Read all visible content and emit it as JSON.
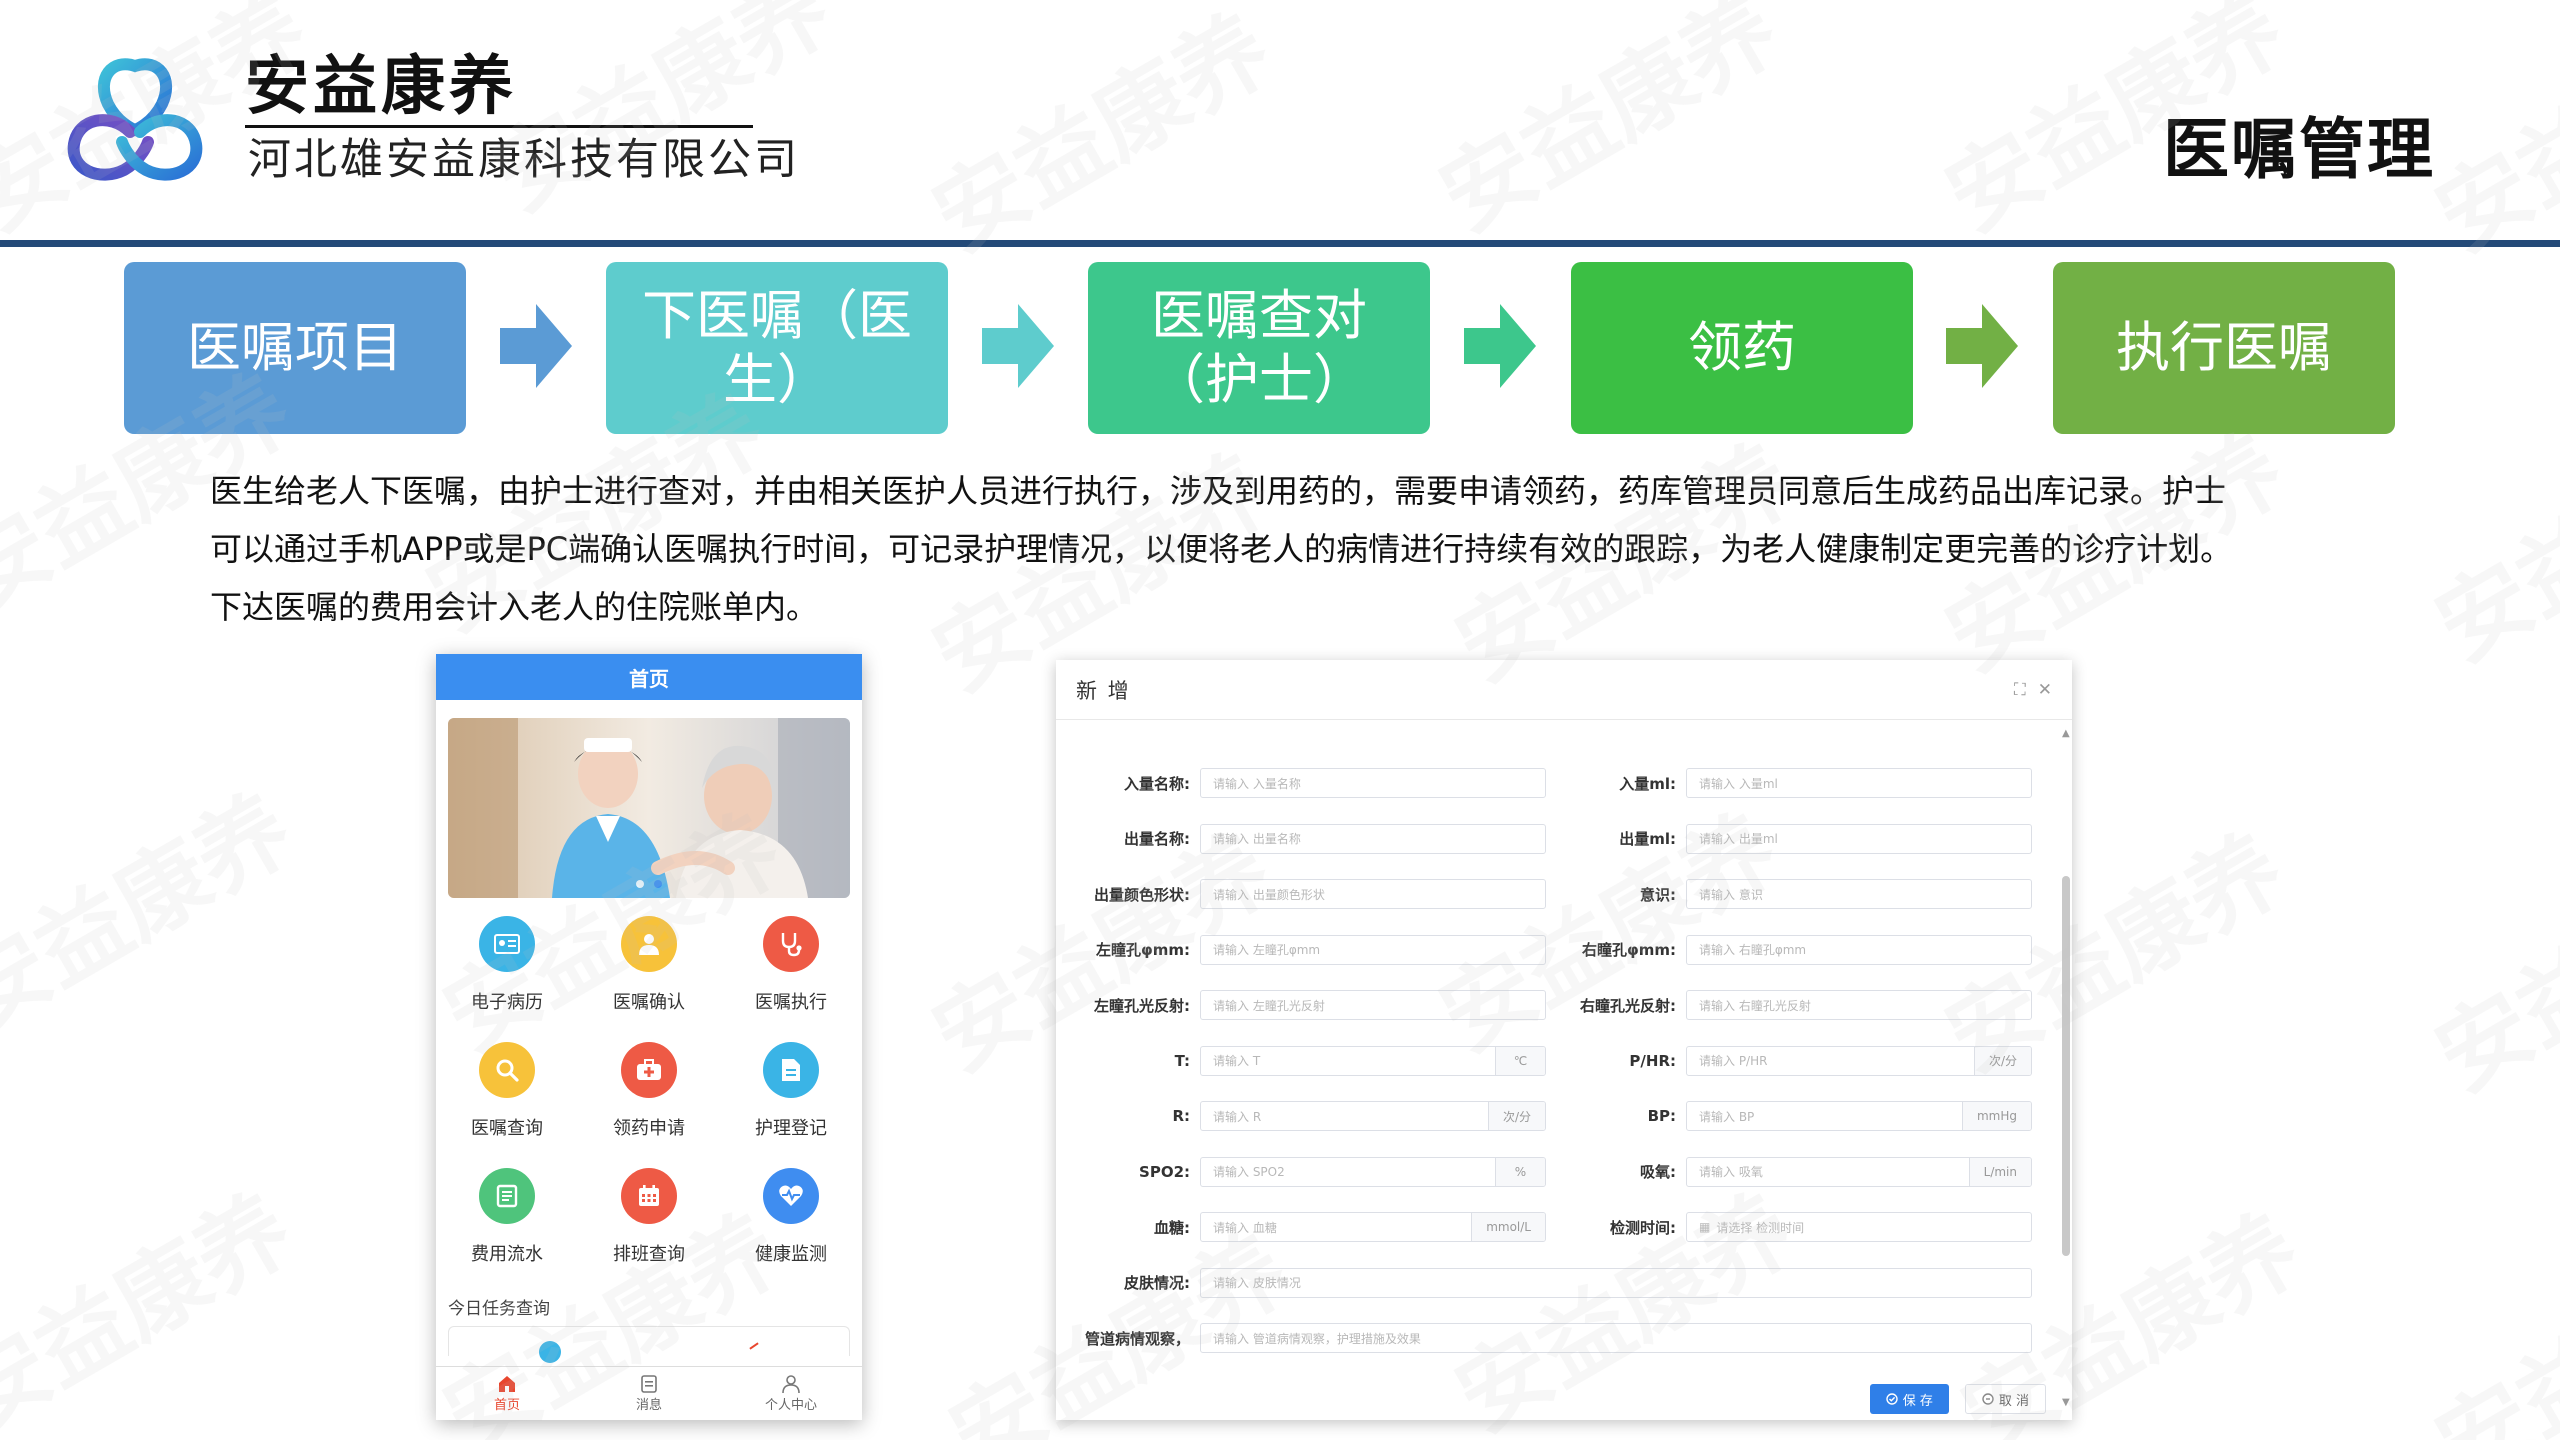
{
  "header": {
    "brand": "安益康养",
    "company": "河北雄安益康科技有限公司",
    "page_title": "医嘱管理"
  },
  "watermark": "安益康养",
  "flow_steps": [
    {
      "label": "医嘱项目",
      "color": "#5b9bd5"
    },
    {
      "label": "下医嘱（医生）",
      "color": "#5ecccd"
    },
    {
      "label": "医嘱查对（护士）",
      "color": "#3dc78c"
    },
    {
      "label": "领药",
      "color": "#3bbf44"
    },
    {
      "label": "执行医嘱",
      "color": "#72b045"
    }
  ],
  "flow_arrow_colors": [
    "#5b9bd5",
    "#5ecccd",
    "#3dc78c",
    "#72b045"
  ],
  "description": [
    "医生给老人下医嘱，由护士进行查对，并由相关医护人员进行执行，涉及到用药的，需要申请领药，药库管理员同意后生成药品出库记录。护士",
    "可以通过手机APP或是PC端确认医嘱执行时间，可记录护理情况，以便将老人的病情进行持续有效的跟踪，为老人健康制定更完善的诊疗计划。",
    "下达医嘱的费用会计入老人的住院账单内。"
  ],
  "phone": {
    "title": "首页",
    "grid": [
      {
        "label": "电子病历",
        "icon": "id-card-icon",
        "color": "#3ab4e6"
      },
      {
        "label": "医嘱确认",
        "icon": "user-icon",
        "color": "#f7c23a"
      },
      {
        "label": "医嘱执行",
        "icon": "stethoscope-icon",
        "color": "#ee5a45"
      },
      {
        "label": "医嘱查询",
        "icon": "search-icon",
        "color": "#f7c23a"
      },
      {
        "label": "领药申请",
        "icon": "medkit-icon",
        "color": "#ee5a45"
      },
      {
        "label": "护理登记",
        "icon": "document-icon",
        "color": "#3ab4e6"
      },
      {
        "label": "费用流水",
        "icon": "ledger-icon",
        "color": "#4fc47c"
      },
      {
        "label": "排班查询",
        "icon": "calendar-icon",
        "color": "#ee5a45"
      },
      {
        "label": "健康监测",
        "icon": "heart-monitor-icon",
        "color": "#3f8df0"
      }
    ],
    "today_title": "今日任务查询",
    "tabs": [
      {
        "label": "首页",
        "active": true
      },
      {
        "label": "消息",
        "active": false
      },
      {
        "label": "个人中心",
        "active": false
      }
    ]
  },
  "dialog": {
    "title": "新 增",
    "left_fields": [
      {
        "label": "入量名称:",
        "placeholder": "请输入 入量名称",
        "unit": ""
      },
      {
        "label": "出量名称:",
        "placeholder": "请输入 出量名称",
        "unit": ""
      },
      {
        "label": "出量颜色形状:",
        "placeholder": "请输入 出量颜色形状",
        "unit": ""
      },
      {
        "label": "左瞳孔φmm:",
        "placeholder": "请输入 左瞳孔φmm",
        "unit": ""
      },
      {
        "label": "左瞳孔光反射:",
        "placeholder": "请输入 左瞳孔光反射",
        "unit": ""
      },
      {
        "label": "T:",
        "placeholder": "请输入 T",
        "unit": "℃"
      },
      {
        "label": "R:",
        "placeholder": "请输入 R",
        "unit": "次/分"
      },
      {
        "label": "SPO2:",
        "placeholder": "请输入 SPO2",
        "unit": "%"
      },
      {
        "label": "血糖:",
        "placeholder": "请输入 血糖",
        "unit": "mmol/L"
      }
    ],
    "right_fields": [
      {
        "label": "入量ml:",
        "placeholder": "请输入 入量ml",
        "unit": ""
      },
      {
        "label": "出量ml:",
        "placeholder": "请输入 出量ml",
        "unit": ""
      },
      {
        "label": "意识:",
        "placeholder": "请输入 意识",
        "unit": ""
      },
      {
        "label": "右瞳孔φmm:",
        "placeholder": "请输入 右瞳孔φmm",
        "unit": ""
      },
      {
        "label": "右瞳孔光反射:",
        "placeholder": "请输入 右瞳孔光反射",
        "unit": ""
      },
      {
        "label": "P/HR:",
        "placeholder": "请输入 P/HR",
        "unit": "次/分"
      },
      {
        "label": "BP:",
        "placeholder": "请输入 BP",
        "unit": "mmHg"
      },
      {
        "label": "吸氧:",
        "placeholder": "请输入 吸氧",
        "unit": "L/min"
      },
      {
        "label": "检测时间:",
        "placeholder": "请选择 检测时间",
        "unit": "",
        "date": true
      }
    ],
    "full_fields": [
      {
        "label": "皮肤情况:",
        "placeholder": "请输入 皮肤情况"
      },
      {
        "label": "管道病情观察，",
        "placeholder": "请输入 管道病情观察，护理措施及效果"
      }
    ],
    "save_label": "保 存",
    "cancel_label": "取 消"
  }
}
